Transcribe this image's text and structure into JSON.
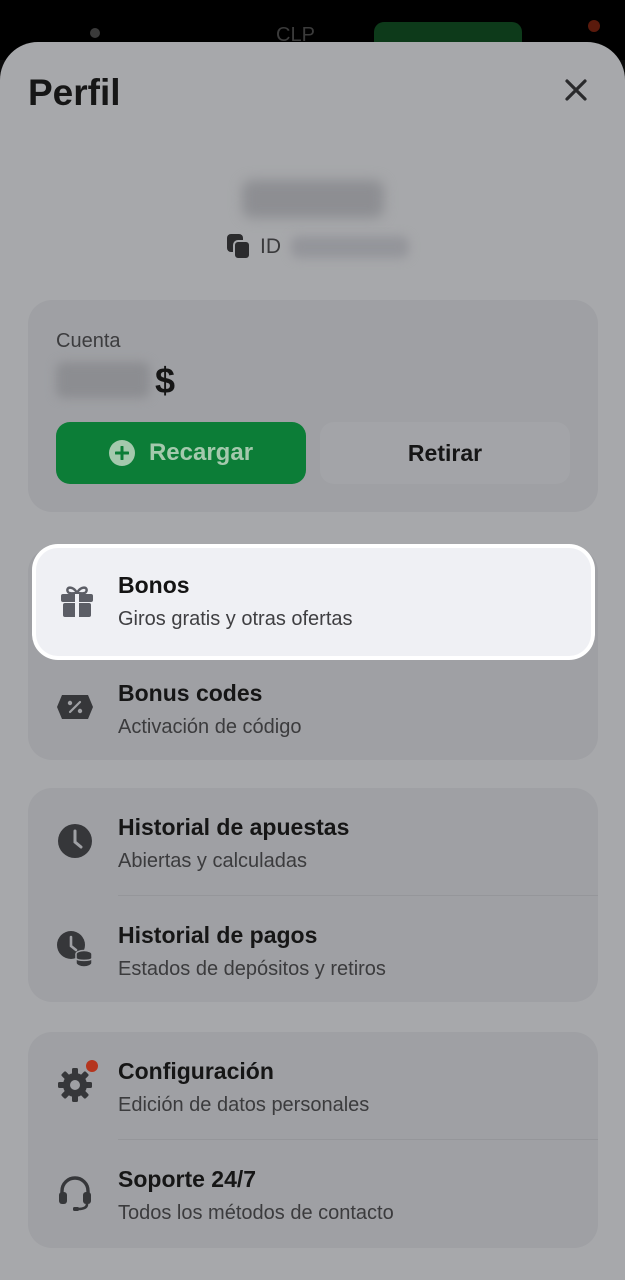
{
  "background": {
    "currency": "CLP"
  },
  "header": {
    "title": "Perfil"
  },
  "profile": {
    "id_label": "ID"
  },
  "account": {
    "label": "Cuenta",
    "currency_symbol": "$",
    "recharge_label": "Recargar",
    "withdraw_label": "Retirar"
  },
  "menu": {
    "bonuses": {
      "title": "Bonos",
      "subtitle": "Giros gratis y otras ofertas"
    },
    "bonus_codes": {
      "title": "Bonus codes",
      "subtitle": "Activación de código"
    },
    "bet_history": {
      "title": "Historial de apuestas",
      "subtitle": "Abiertas y calculadas"
    },
    "payment_history": {
      "title": "Historial de pagos",
      "subtitle": "Estados de depósitos y retiros"
    },
    "settings": {
      "title": "Configuración",
      "subtitle": "Edición de datos personales"
    },
    "support": {
      "title": "Soporte 24/7",
      "subtitle": "Todos los métodos de contacto"
    }
  },
  "colors": {
    "accent_green": "#0c7d37",
    "notification": "#b5351e",
    "highlight_bg": "#eff0f4"
  }
}
